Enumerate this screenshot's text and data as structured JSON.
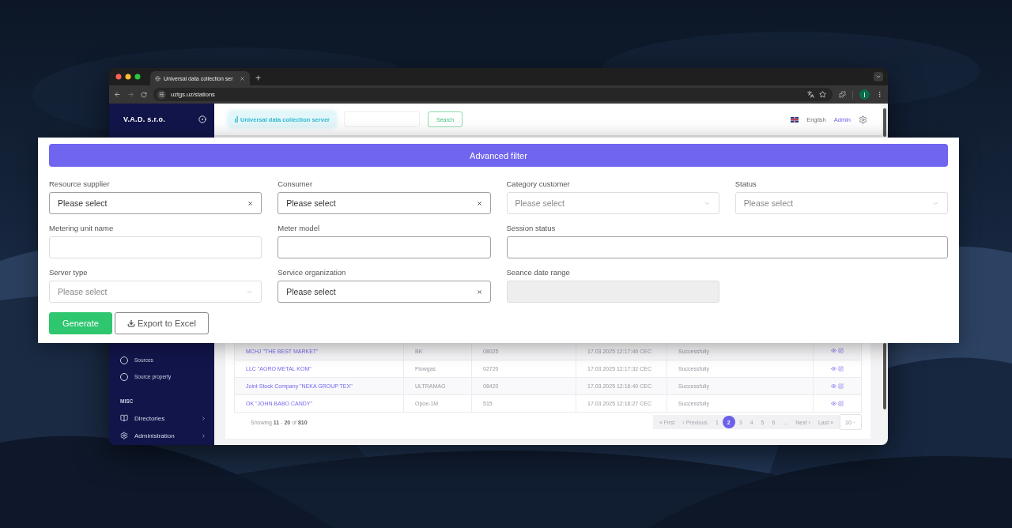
{
  "browser": {
    "tab_title": "Universal data collection ser",
    "url": "uztgs.uz/stations",
    "profile_initial": "I"
  },
  "sidebar": {
    "brand": "V.A.D. s.r.o.",
    "items": [
      {
        "kind": "radio",
        "label": "Sources"
      },
      {
        "kind": "radio",
        "label": "Source property"
      },
      {
        "kind": "section",
        "label": "MISC"
      },
      {
        "kind": "menu",
        "label": "Directories"
      },
      {
        "kind": "menu",
        "label": "Administration"
      }
    ]
  },
  "header": {
    "app_badge": "Universal data collection server",
    "search_button": "Search",
    "language": "English",
    "user": "Admin"
  },
  "filter": {
    "title": "Advanced filter",
    "fields": [
      {
        "label": "Resource supplier",
        "kind": "clearable",
        "placeholder": "Please select"
      },
      {
        "label": "Consumer",
        "kind": "clearable",
        "placeholder": "Please select"
      },
      {
        "label": "Category customer",
        "kind": "dropdown",
        "placeholder": "Please select"
      },
      {
        "label": "Status",
        "kind": "dropdown",
        "placeholder": "Please select"
      },
      {
        "label": "Metering unit name",
        "kind": "text"
      },
      {
        "label": "Meter model",
        "kind": "text"
      },
      {
        "label": "Session status",
        "kind": "wide"
      },
      {
        "label": "Server type",
        "kind": "dropdown",
        "placeholder": "Please select"
      },
      {
        "label": "Service organization",
        "kind": "clearable",
        "placeholder": "Please select"
      },
      {
        "label": "Seance date range",
        "kind": "range",
        "disabled": true
      }
    ],
    "buttons": [
      {
        "kind": "primary",
        "label": "Generate"
      },
      {
        "kind": "export",
        "label": "Export to Excel"
      }
    ]
  },
  "table": {
    "rows": [
      {
        "cells": [
          "MCHJ \"THE BEST MARKET\"",
          "BK",
          "08025",
          "17.03.2025 12:17:46 CEC",
          "Successfully"
        ]
      },
      {
        "cells": [
          "LLC \"AGRO METAL KOM\"",
          "Flowgas",
          "02720",
          "17.03.2025 12:17:32 CEC",
          "Successfully"
        ]
      },
      {
        "cells": [
          "Joint Stock Company \"NEKA GROUP TEX\"",
          "ULTRAMAG",
          "08420",
          "17.03.2025 12:16:40 CEC",
          "Successfully"
        ]
      },
      {
        "cells": [
          "OK \"JOHN BABO CANDY\"",
          "Opoe-1M",
          "515",
          "17.03.2025 12:16:27 CEC",
          "Successfully"
        ]
      }
    ]
  },
  "footer": {
    "showing": "Showing **11** - **20** of **810**",
    "pagination": [
      {
        "label": "« First",
        "selected": false
      },
      {
        "label": "‹ Previous",
        "selected": false
      },
      {
        "label": "1",
        "selected": false
      },
      {
        "label": "2",
        "selected": true
      },
      {
        "label": "3",
        "selected": false
      },
      {
        "label": "4",
        "selected": false
      },
      {
        "label": "5",
        "selected": false
      },
      {
        "label": "6",
        "selected": false
      },
      {
        "label": "...",
        "selected": false
      },
      {
        "label": "Next ›",
        "selected": false
      },
      {
        "label": "Last »",
        "selected": false
      }
    ],
    "page_size": "10"
  }
}
